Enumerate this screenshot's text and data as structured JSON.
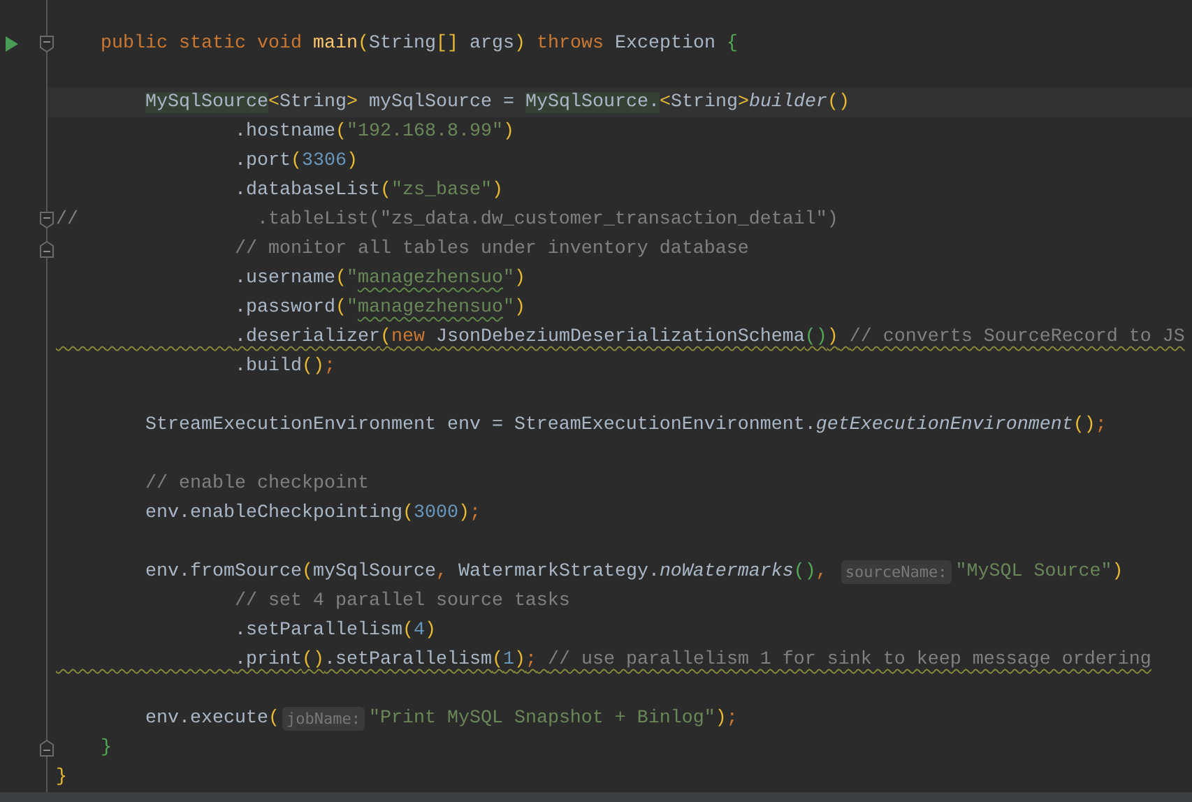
{
  "editor": {
    "lines": [
      {
        "kind": "blank"
      },
      {
        "kind": "code",
        "warning": false,
        "gutter": [
          {
            "kind": "run"
          },
          {
            "kind": "fold_start"
          }
        ],
        "tokens": [
          {
            "kind": "kw",
            "text": "    public static void "
          },
          {
            "kind": "decl",
            "text": "main"
          },
          {
            "kind": "b1",
            "text": "("
          },
          {
            "kind": "plain",
            "text": "String"
          },
          {
            "kind": "b1",
            "text": "[]"
          },
          {
            "kind": "plain",
            "text": " args"
          },
          {
            "kind": "b1",
            "text": ")"
          },
          {
            "kind": "kw",
            "text": " throws "
          },
          {
            "kind": "plain",
            "text": "Exception "
          },
          {
            "kind": "b2",
            "text": "{"
          }
        ]
      },
      {
        "kind": "blank"
      },
      {
        "kind": "caret_line",
        "warning": false,
        "tokens": [
          {
            "kind": "usage",
            "text": "        MySqlSource"
          },
          {
            "kind": "b1",
            "text": "<"
          },
          {
            "kind": "plain",
            "text": "String"
          },
          {
            "kind": "b1",
            "text": ">"
          },
          {
            "kind": "plain",
            "text": " mySqlSource = "
          },
          {
            "kind": "usage",
            "text": "MySqlSource."
          },
          {
            "kind": "b1",
            "text": "<"
          },
          {
            "kind": "plain",
            "text": "String"
          },
          {
            "kind": "b1",
            "text": ">"
          },
          {
            "kind": "static",
            "text": "builder"
          },
          {
            "kind": "b1",
            "text": "()"
          }
        ]
      },
      {
        "kind": "code",
        "warning": false,
        "tokens": [
          {
            "kind": "plain",
            "text": "                .hostname"
          },
          {
            "kind": "b1",
            "text": "("
          },
          {
            "kind": "str",
            "text": "\"192.168.8.99\""
          },
          {
            "kind": "b1",
            "text": ")"
          }
        ]
      },
      {
        "kind": "code",
        "warning": false,
        "tokens": [
          {
            "kind": "plain",
            "text": "                .port"
          },
          {
            "kind": "b1",
            "text": "("
          },
          {
            "kind": "num",
            "text": "3306"
          },
          {
            "kind": "b1",
            "text": ")"
          }
        ]
      },
      {
        "kind": "code",
        "warning": false,
        "tokens": [
          {
            "kind": "plain",
            "text": "                .databaseList"
          },
          {
            "kind": "b1",
            "text": "("
          },
          {
            "kind": "str",
            "text": "\"zs_base\""
          },
          {
            "kind": "b1",
            "text": ")"
          }
        ]
      },
      {
        "kind": "code",
        "warning": false,
        "gutter": [
          {
            "kind": "fold_start"
          }
        ],
        "tokens": [
          {
            "kind": "comment",
            "text": "//                .tableList(\"zs_data.dw_customer_transaction_detail\")"
          }
        ]
      },
      {
        "kind": "code",
        "warning": false,
        "gutter": [
          {
            "kind": "fold_end"
          }
        ],
        "tokens": [
          {
            "kind": "comment",
            "text": "                // monitor all tables under inventory database"
          }
        ]
      },
      {
        "kind": "code",
        "warning": false,
        "tokens": [
          {
            "kind": "plain",
            "text": "                .username"
          },
          {
            "kind": "b1",
            "text": "("
          },
          {
            "kind": "str",
            "text": "\""
          },
          {
            "kind": "typo",
            "text": "managezhensuo"
          },
          {
            "kind": "str",
            "text": "\""
          },
          {
            "kind": "b1",
            "text": ")"
          }
        ]
      },
      {
        "kind": "code",
        "warning": false,
        "tokens": [
          {
            "kind": "plain",
            "text": "                .password"
          },
          {
            "kind": "b1",
            "text": "("
          },
          {
            "kind": "str",
            "text": "\""
          },
          {
            "kind": "typo",
            "text": "managezhensuo"
          },
          {
            "kind": "str",
            "text": "\""
          },
          {
            "kind": "b1",
            "text": ")"
          }
        ]
      },
      {
        "kind": "code",
        "warning": true,
        "tokens": [
          {
            "kind": "plain",
            "text": "                .deserializer"
          },
          {
            "kind": "b1",
            "text": "("
          },
          {
            "kind": "kw",
            "text": "new "
          },
          {
            "kind": "plain",
            "text": "JsonDebeziumDeserializationSchema"
          },
          {
            "kind": "b2",
            "text": "()"
          },
          {
            "kind": "b1",
            "text": ")"
          },
          {
            "kind": "comment",
            "text": " // converts SourceRecord to JS"
          }
        ]
      },
      {
        "kind": "code",
        "warning": false,
        "tokens": [
          {
            "kind": "plain",
            "text": "                .build"
          },
          {
            "kind": "b1",
            "text": "()"
          },
          {
            "kind": "semi",
            "text": ";"
          }
        ]
      },
      {
        "kind": "blank"
      },
      {
        "kind": "code",
        "warning": false,
        "tokens": [
          {
            "kind": "plain",
            "text": "        StreamExecutionEnvironment env = StreamExecutionEnvironment."
          },
          {
            "kind": "static",
            "text": "getExecutionEnvironment"
          },
          {
            "kind": "b1",
            "text": "()"
          },
          {
            "kind": "semi",
            "text": ";"
          }
        ]
      },
      {
        "kind": "blank"
      },
      {
        "kind": "code",
        "warning": false,
        "tokens": [
          {
            "kind": "comment",
            "text": "        // enable checkpoint"
          }
        ]
      },
      {
        "kind": "code",
        "warning": false,
        "tokens": [
          {
            "kind": "plain",
            "text": "        env.enableCheckpointing"
          },
          {
            "kind": "b1",
            "text": "("
          },
          {
            "kind": "num",
            "text": "3000"
          },
          {
            "kind": "b1",
            "text": ")"
          },
          {
            "kind": "semi",
            "text": ";"
          }
        ]
      },
      {
        "kind": "blank"
      },
      {
        "kind": "code",
        "warning": false,
        "tokens": [
          {
            "kind": "plain",
            "text": "        env.fromSource"
          },
          {
            "kind": "b1",
            "text": "("
          },
          {
            "kind": "plain",
            "text": "mySqlSource"
          },
          {
            "kind": "semi",
            "text": ", "
          },
          {
            "kind": "plain",
            "text": "WatermarkStrategy."
          },
          {
            "kind": "static",
            "text": "noWatermarks"
          },
          {
            "kind": "b2",
            "text": "()"
          },
          {
            "kind": "semi",
            "text": ", "
          },
          {
            "kind": "hint",
            "text": "sourceName:"
          },
          {
            "kind": "str",
            "text": "\"MySQL Source\""
          },
          {
            "kind": "b1",
            "text": ")"
          }
        ]
      },
      {
        "kind": "code",
        "warning": false,
        "tokens": [
          {
            "kind": "comment",
            "text": "                // set 4 parallel source tasks"
          }
        ]
      },
      {
        "kind": "code",
        "warning": false,
        "tokens": [
          {
            "kind": "plain",
            "text": "                .setParallelism"
          },
          {
            "kind": "b1",
            "text": "("
          },
          {
            "kind": "num",
            "text": "4"
          },
          {
            "kind": "b1",
            "text": ")"
          }
        ]
      },
      {
        "kind": "code",
        "warning": true,
        "tokens": [
          {
            "kind": "plain",
            "text": "                .print"
          },
          {
            "kind": "b1",
            "text": "()"
          },
          {
            "kind": "plain",
            "text": ".setParallelism"
          },
          {
            "kind": "b1",
            "text": "("
          },
          {
            "kind": "num",
            "text": "1"
          },
          {
            "kind": "b1",
            "text": ")"
          },
          {
            "kind": "semi",
            "text": ";"
          },
          {
            "kind": "comment",
            "text": " // use parallelism 1 for sink to keep message ordering"
          }
        ]
      },
      {
        "kind": "blank"
      },
      {
        "kind": "code",
        "warning": false,
        "tokens": [
          {
            "kind": "plain",
            "text": "        env.execute"
          },
          {
            "kind": "b1",
            "text": "("
          },
          {
            "kind": "hint",
            "text": "jobName:"
          },
          {
            "kind": "str",
            "text": "\"Print MySQL Snapshot + Binlog\""
          },
          {
            "kind": "b1",
            "text": ")"
          },
          {
            "kind": "semi",
            "text": ";"
          }
        ]
      },
      {
        "kind": "code",
        "warning": false,
        "gutter": [
          {
            "kind": "fold_end"
          }
        ],
        "tokens": [
          {
            "kind": "b2",
            "text": "    }"
          }
        ]
      },
      {
        "kind": "code",
        "warning": false,
        "tokens": [
          {
            "kind": "b1",
            "text": "}"
          }
        ]
      }
    ]
  }
}
